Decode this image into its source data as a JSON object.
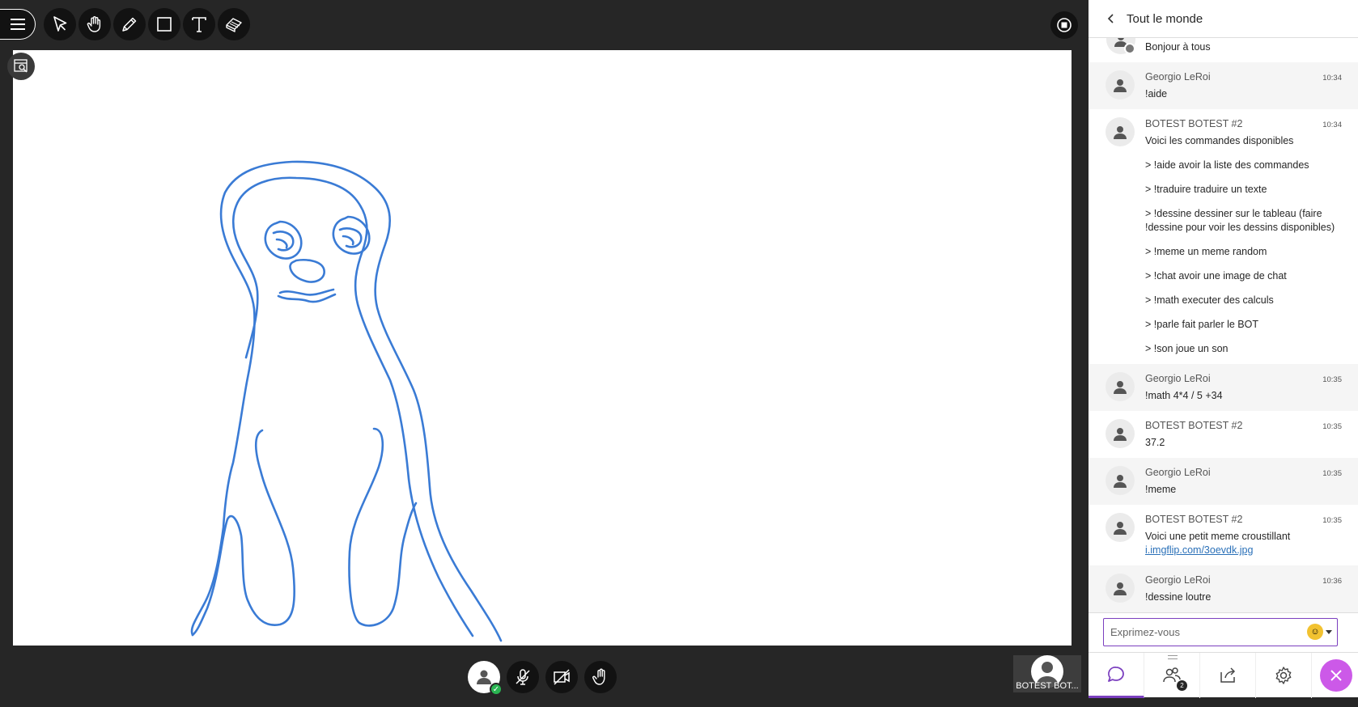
{
  "toolbar": {
    "tools": [
      "menu-icon",
      "select-pointer-icon",
      "pan-hand-icon",
      "pencil-icon",
      "rectangle-icon",
      "text-icon",
      "eraser-icon"
    ]
  },
  "chat": {
    "title": "Tout le monde",
    "first_message": "Bonjour à tous",
    "messages": [
      {
        "author": "Georgio LeRoi",
        "time": "10:34",
        "text": "!aide"
      },
      {
        "author": "BOTEST BOTEST #2",
        "time": "10:34",
        "text": "Voici les commandes disponibles",
        "commands": [
          "> !aide avoir la liste des commandes",
          "> !traduire traduire un texte",
          "> !dessine dessiner sur le tableau (faire !dessine pour voir les dessins disponibles)",
          "> !meme un meme random",
          "> !chat avoir une image de chat",
          "> !math executer des calculs",
          "> !parle fait parler le BOT",
          "> !son joue un son"
        ]
      },
      {
        "author": "Georgio LeRoi",
        "time": "10:35",
        "text": "!math 4*4 / 5 +34"
      },
      {
        "author": "BOTEST BOTEST #2",
        "time": "10:35",
        "text": "37.2"
      },
      {
        "author": "Georgio LeRoi",
        "time": "10:35",
        "text": "!meme"
      },
      {
        "author": "BOTEST BOTEST #2",
        "time": "10:35",
        "text": "Voici une petit meme croustillant",
        "link": "i.imgflip.com/3oevdk.jpg"
      },
      {
        "author": "Georgio LeRoi",
        "time": "10:36",
        "text": "!dessine loutre"
      }
    ],
    "composer_placeholder": "Exprimez-vous",
    "participant_count": "2"
  },
  "participant_tile": {
    "name": "BOTEST BOT..."
  },
  "colors": {
    "accent": "#7b3fbf",
    "drawing": "#3a7bd5",
    "close": "#cc59e8"
  }
}
